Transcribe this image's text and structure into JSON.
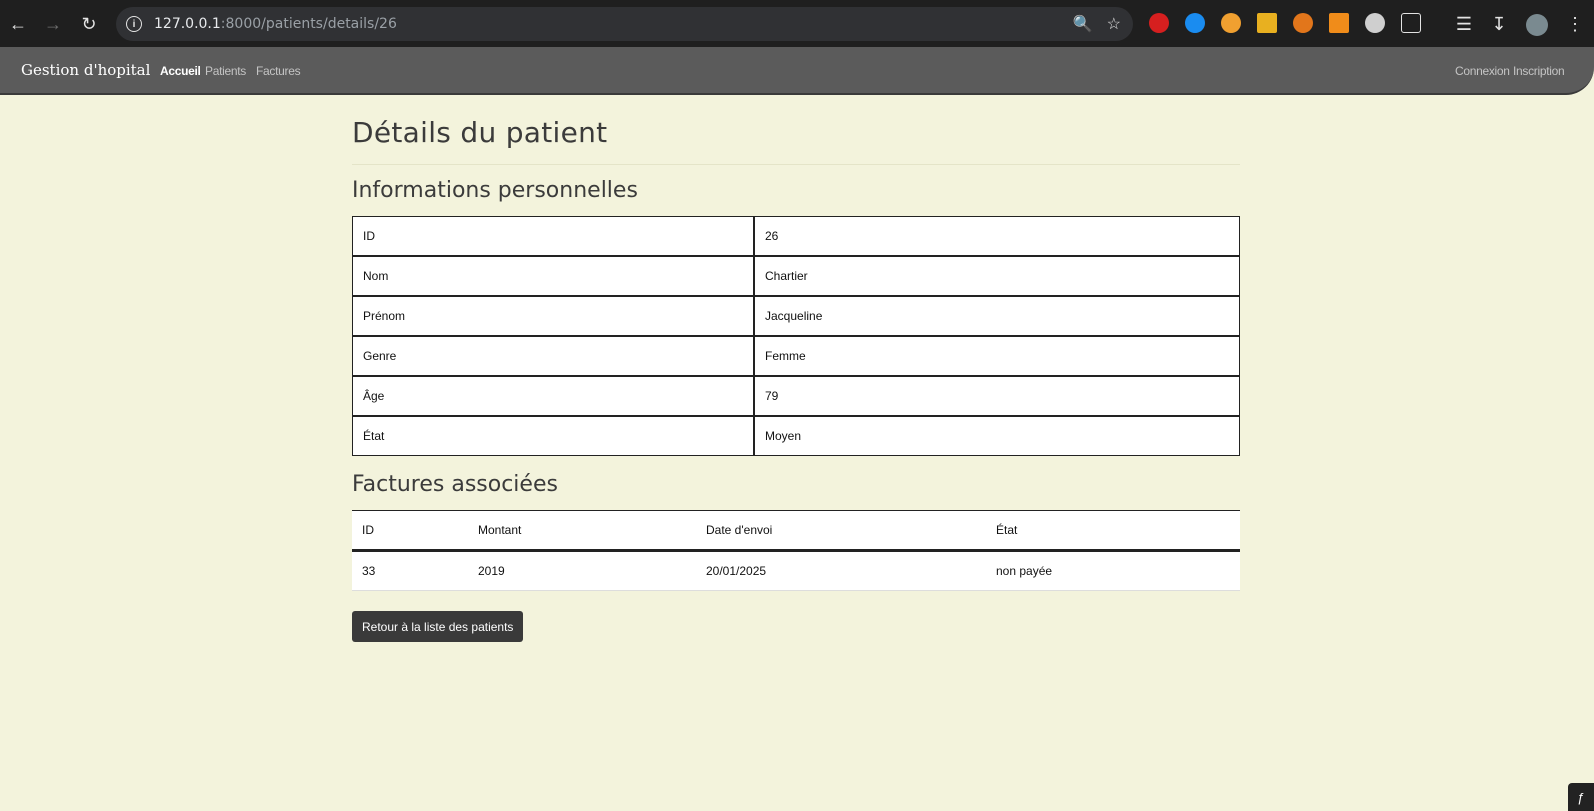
{
  "browser": {
    "url_host": "127.0.0.1",
    "url_path": ":8000/patients/details/26"
  },
  "navbar": {
    "brand": "Gestion d'hopital",
    "links": [
      {
        "label": "Accueil"
      },
      {
        "label": "Patients"
      },
      {
        "label": "Factures"
      }
    ],
    "right_links": [
      {
        "label": "Connexion"
      },
      {
        "label": "Inscription"
      }
    ]
  },
  "page": {
    "title": "Détails du patient",
    "personal_heading": "Informations personnelles",
    "personal": [
      {
        "key": "ID",
        "value": "26"
      },
      {
        "key": "Nom",
        "value": "Chartier"
      },
      {
        "key": "Prénom",
        "value": "Jacqueline"
      },
      {
        "key": "Genre",
        "value": "Femme"
      },
      {
        "key": "Âge",
        "value": "79"
      },
      {
        "key": "État",
        "value": "Moyen"
      }
    ],
    "invoices_heading": "Factures associées",
    "invoice_columns": [
      "ID",
      "Montant",
      "Date d'envoi",
      "État"
    ],
    "invoices": [
      {
        "id": "33",
        "amount": "2019",
        "date": "20/01/2025",
        "state": "non payée"
      }
    ],
    "back_button": "Retour à la liste des patients"
  },
  "colors": {
    "page_bg": "#f3f3dc",
    "navbar_bg": "#5b5b5b",
    "button_bg": "#3a3a3a"
  }
}
